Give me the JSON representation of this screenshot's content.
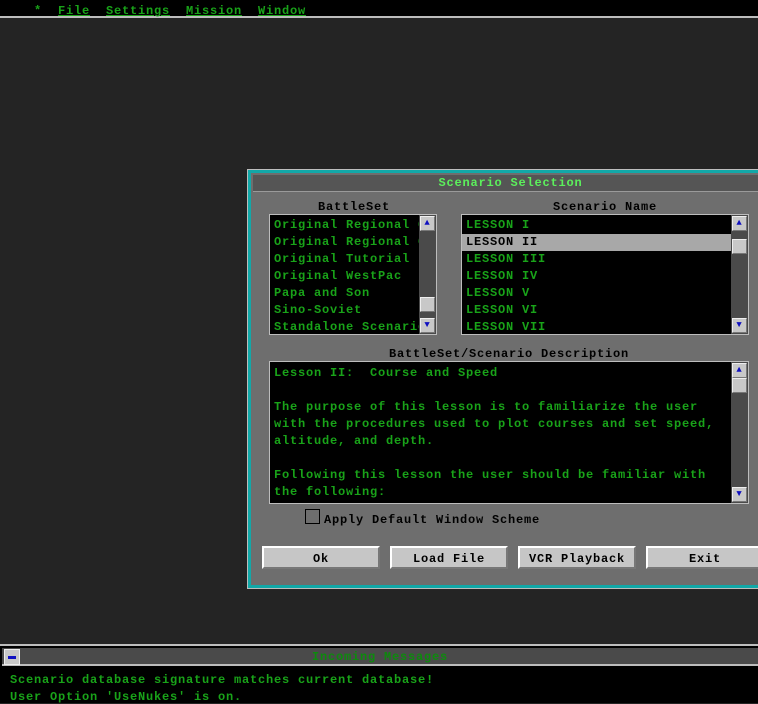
{
  "menu": {
    "system": "*",
    "items": [
      "File",
      "Settings",
      "Mission",
      "Window"
    ]
  },
  "dialog": {
    "title": "Scenario Selection",
    "battleset_label": "BattleSet",
    "scenario_label": "Scenario Name",
    "battlesets": [
      "Original Regional C",
      "Original Regional C",
      "Original Tutorial",
      "Original WestPac",
      "Papa and Son",
      "Sino-Soviet",
      "Standalone Scenarios"
    ],
    "scenarios": [
      "LESSON I",
      "LESSON II",
      "LESSON III",
      "LESSON IV",
      "LESSON V",
      "LESSON VI",
      "LESSON VII"
    ],
    "selected_scenario": "LESSON II",
    "description_label": "BattleSet/Scenario Description",
    "description": [
      "Lesson II:  Course and Speed",
      "",
      "The purpose of this lesson is to familiarize the user",
      "with the procedures used to plot courses and set speed,",
      "altitude, and depth.",
      "",
      "Following this lesson the user should be familiar with",
      "the following:"
    ],
    "checkbox_label": "Apply Default Window Scheme",
    "checkbox_checked": false,
    "buttons": {
      "ok": "Ok",
      "load": "Load File",
      "vcr": "VCR Playback",
      "exit": "Exit"
    }
  },
  "messages": {
    "title": "Incoming Messages",
    "lines": [
      "Scenario database signature matches current database!",
      "User Option 'UseNukes' is on."
    ]
  }
}
